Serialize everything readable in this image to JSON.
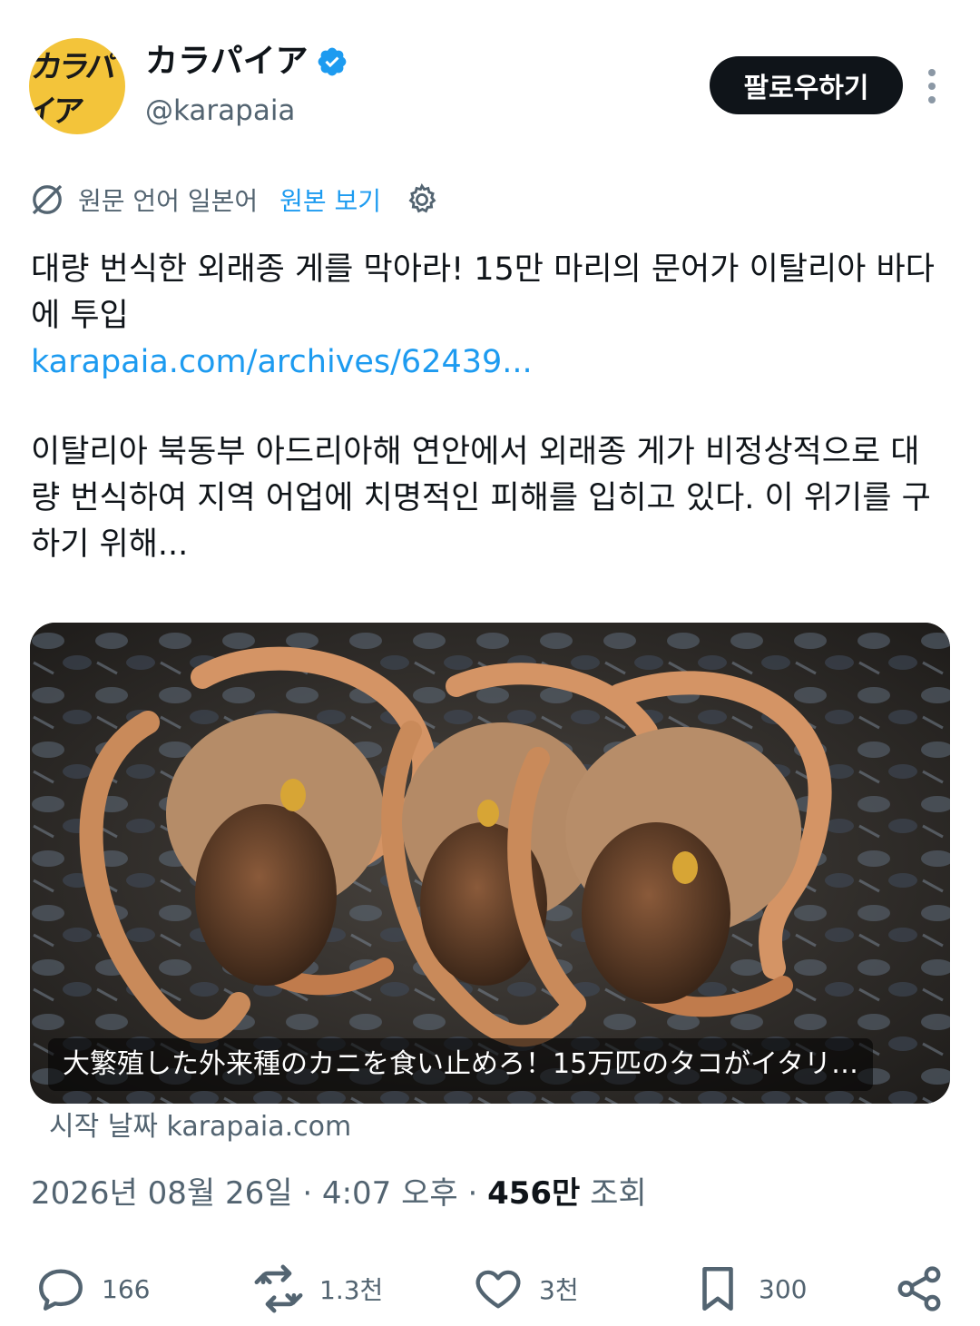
{
  "author": {
    "avatar_text": "カラパイア",
    "display_name": "カラパイア",
    "handle": "@karapaia"
  },
  "follow_button": "팔로우하기",
  "translation": {
    "source_language": "원문 언어 일본어",
    "show_original": "원본 보기"
  },
  "tweet": {
    "headline": "대량 번식한 외래종 게를 막아라! 15만 마리의 문어가 이탈리아 바다에 투입",
    "link": "karapaia.com/archives/62439...",
    "body": "이탈리아 북동부 아드리아해 연안에서 외래종 게가 비정상적으로 대량 번식하여 지역 어업에 치명적인 피해를 입히고 있다. 이 위기를 구하기 위해..."
  },
  "card": {
    "caption": "大繁殖した外来種のカニを食い止めろ！15万匹のタコがイタリ…",
    "source": "시작 날짜 karapaia.com"
  },
  "meta": {
    "datetime": "2026년 08월 26일 · 4:07 오후 · ",
    "views_count": "456만",
    "views_label": " 조회"
  },
  "actions": {
    "replies": "166",
    "reposts": "1.3천",
    "likes": "3천",
    "bookmarks": "300"
  },
  "colors": {
    "accent": "#1d9bf0",
    "text": "#0f1419",
    "secondary": "#536471",
    "avatar_bg": "#f3c43a"
  }
}
